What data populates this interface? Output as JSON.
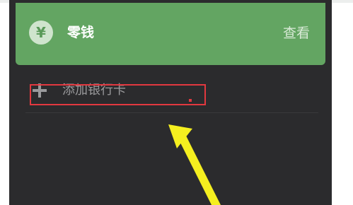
{
  "wallet_card": {
    "icon": "yen-icon",
    "title": "零钱",
    "action_label": "查看",
    "color": "#63a562"
  },
  "add_bank_card": {
    "icon": "plus-icon",
    "label": "添加银行卡"
  },
  "annotation": {
    "box_color": "#e2383f",
    "arrow_color": "#f5ef1f"
  },
  "yen_symbol": "¥"
}
